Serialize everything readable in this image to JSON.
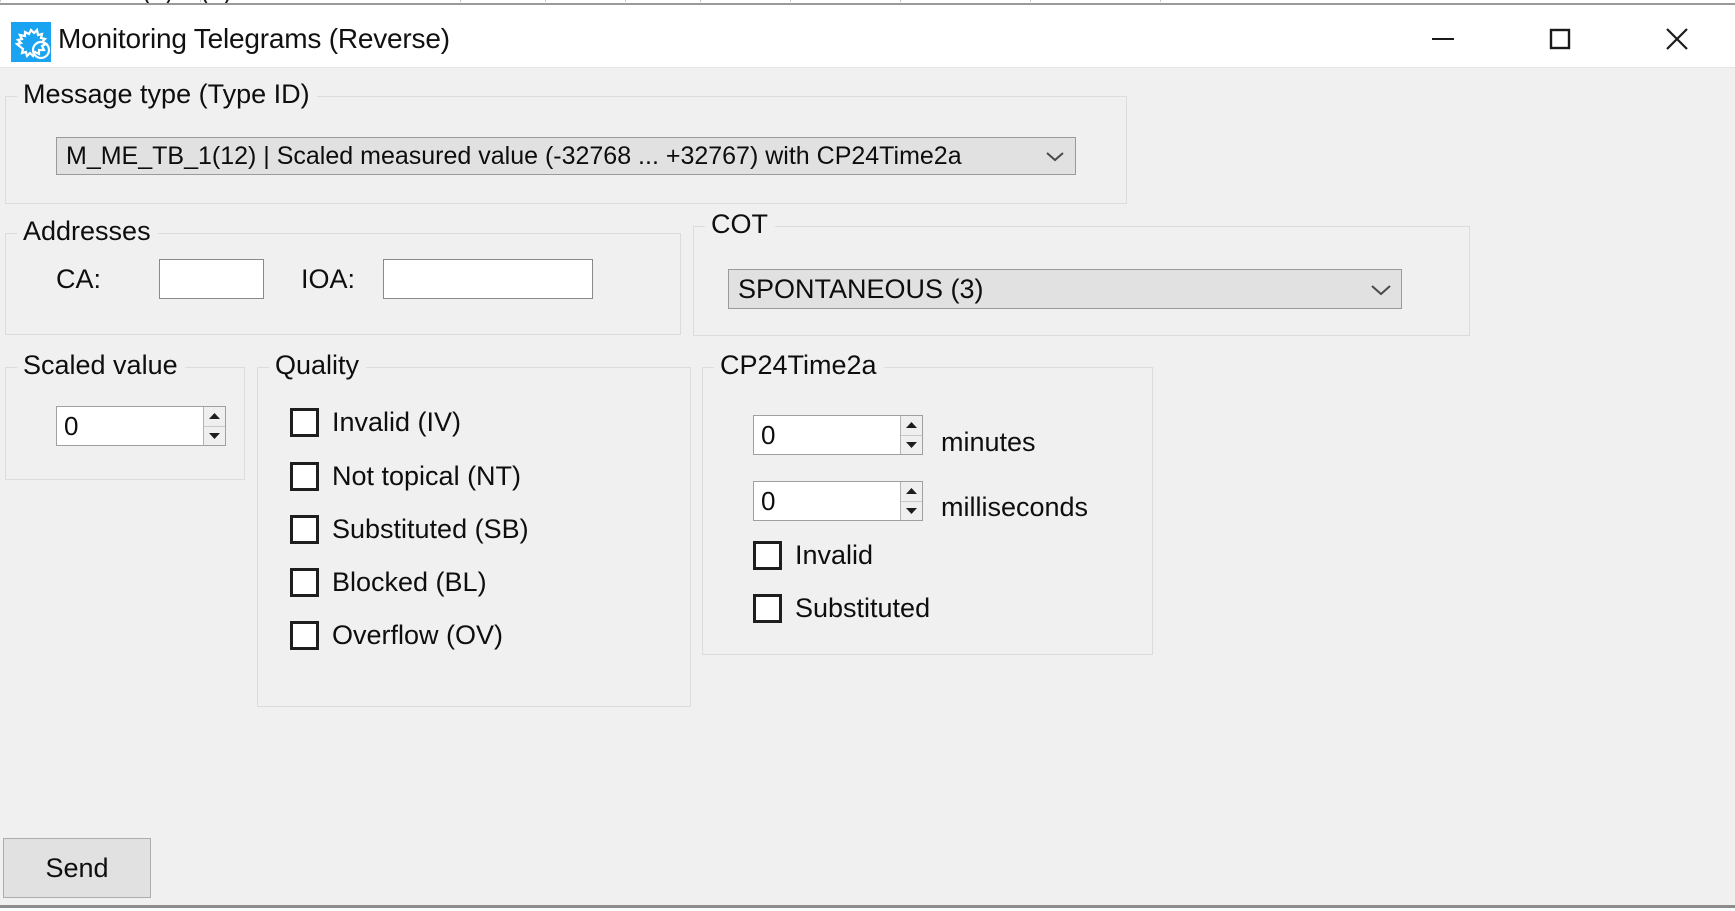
{
  "window": {
    "title": "Monitoring Telegrams (Reverse)",
    "icon": "gear-app-icon",
    "icon_bg": "#1aa3f0",
    "controls": {
      "minimize": "–",
      "maximize": "☐",
      "close": "×"
    }
  },
  "message_type": {
    "legend": "Message type (Type ID)",
    "selected": "M_ME_TB_1(12) | Scaled measured value (-32768 ... +32767) with CP24Time2a"
  },
  "addresses": {
    "legend": "Addresses",
    "ca_label": "CA:",
    "ca_value": "",
    "ioa_label": "IOA:",
    "ioa_value": ""
  },
  "cot": {
    "legend": "COT",
    "selected": "SPONTANEOUS (3)"
  },
  "scaled_value": {
    "legend": "Scaled value",
    "value": "0"
  },
  "quality": {
    "legend": "Quality",
    "items": [
      {
        "label": "Invalid (IV)",
        "checked": false
      },
      {
        "label": "Not topical (NT)",
        "checked": false
      },
      {
        "label": "Substituted (SB)",
        "checked": false
      },
      {
        "label": "Blocked (BL)",
        "checked": false
      },
      {
        "label": "Overflow (OV)",
        "checked": false
      }
    ]
  },
  "cp24time2a": {
    "legend": "CP24Time2a",
    "minutes_value": "0",
    "minutes_label": "minutes",
    "milliseconds_value": "0",
    "milliseconds_label": "milliseconds",
    "invalid_label": "Invalid",
    "invalid_checked": false,
    "substituted_label": "Substituted",
    "substituted_checked": false
  },
  "actions": {
    "send_label": "Send"
  },
  "colors": {
    "accent": "#1aa3f0",
    "window_bg": "#f0f0f0",
    "titlebar_bg": "#ffffff",
    "control_bg": "#e1e1e1",
    "field_bg": "#ffffff",
    "group_border": "#dcdcdc"
  }
}
